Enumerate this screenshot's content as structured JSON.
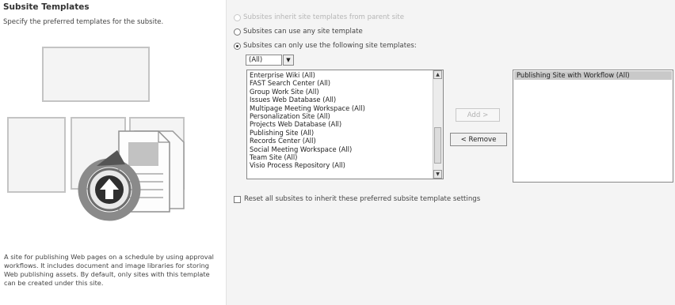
{
  "left": {
    "title": "Subsite Templates",
    "description": "Specify the preferred templates for the subsite.",
    "preview_description": "A site for publishing Web pages on a schedule by using approval workflows. It includes document and image libraries for storing Web publishing assets. By default, only sites with this template can be created under this site."
  },
  "options": {
    "inherit": "Subsites inherit site templates from parent site",
    "any": "Subsites can use any site template",
    "only": "Subsites can only use the following site templates:"
  },
  "filter": {
    "selected": "(All)"
  },
  "available": [
    "Enterprise Wiki (All)",
    "FAST Search Center (All)",
    "Group Work Site (All)",
    "Issues Web Database (All)",
    "Multipage Meeting Workspace (All)",
    "Personalization Site (All)",
    "Projects Web Database (All)",
    "Publishing Site (All)",
    "Records Center (All)",
    "Social Meeting Workspace (All)",
    "Team Site (All)",
    "Visio Process Repository (All)"
  ],
  "buttons": {
    "add": "Add >",
    "remove": "< Remove"
  },
  "selected": [
    "Publishing Site with Workflow (All)"
  ],
  "reset_label": "Reset all subsites to inherit these preferred subsite template settings",
  "icons": {
    "scroll_up": "scroll-up-icon",
    "scroll_down": "scroll-down-icon",
    "dropdown": "chevron-down-icon"
  }
}
